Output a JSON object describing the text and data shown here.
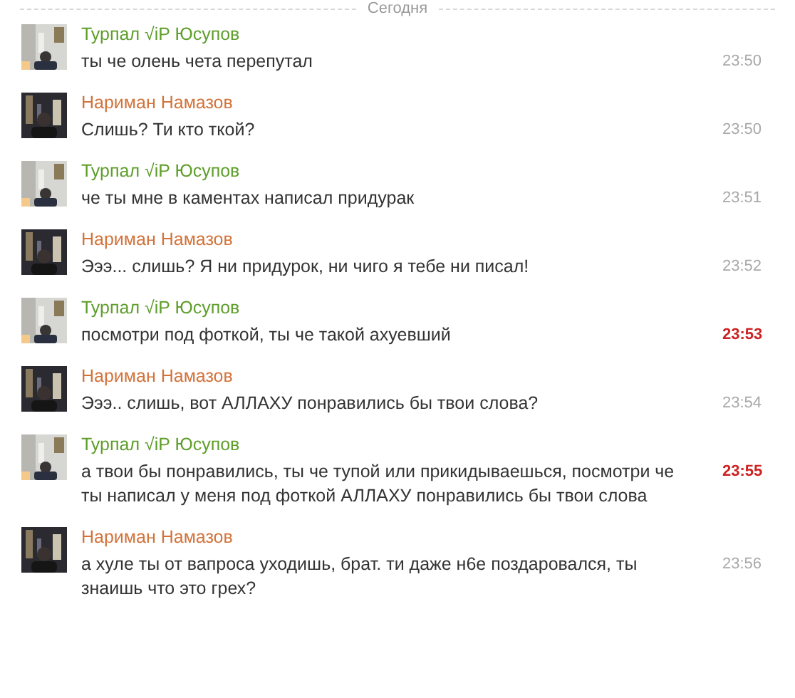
{
  "date_divider": "Сегодня",
  "messages": [
    {
      "author": "Турпал √iP Юсупов",
      "color": "#5e9e2a",
      "online": true,
      "text": "ты че олень чета перепутал",
      "time": "23:50",
      "unread": false
    },
    {
      "author": "Нариман Намазов",
      "color": "#d2733b",
      "online": false,
      "text": "Слишь? Ти кто ткой?",
      "time": "23:50",
      "unread": false
    },
    {
      "author": "Турпал √iP Юсупов",
      "color": "#5e9e2a",
      "online": true,
      "text": "че ты мне в каментах написал придурак",
      "time": "23:51",
      "unread": false
    },
    {
      "author": "Нариман Намазов",
      "color": "#d2733b",
      "online": false,
      "text": "Эээ... слишь? Я ни придурок, ни чиго я тебе ни писал!",
      "time": "23:52",
      "unread": false
    },
    {
      "author": "Турпал √iP Юсупов",
      "color": "#5e9e2a",
      "online": true,
      "text": "посмотри под фоткой, ты че такой ахуевший",
      "time": "23:53",
      "unread": true
    },
    {
      "author": "Нариман Намазов",
      "color": "#d2733b",
      "online": false,
      "text": "Эээ.. слишь, вот АЛЛАХУ понравились бы твои слова?",
      "time": "23:54",
      "unread": false
    },
    {
      "author": "Турпал √iP Юсупов",
      "color": "#5e9e2a",
      "online": true,
      "text": "а твои бы понравились, ты че тупой или прикидываешься, посмотри че ты написал у меня под фоткой АЛЛАХУ понравились бы твои слова",
      "time": "23:55",
      "unread": true
    },
    {
      "author": "Нариман Намазов",
      "color": "#d2733b",
      "online": false,
      "text": "а хуле ты от вапроса уходишь, брат. ти даже н6е поздаровался, ты знаишь что это грех?",
      "time": "23:56",
      "unread": false
    }
  ]
}
